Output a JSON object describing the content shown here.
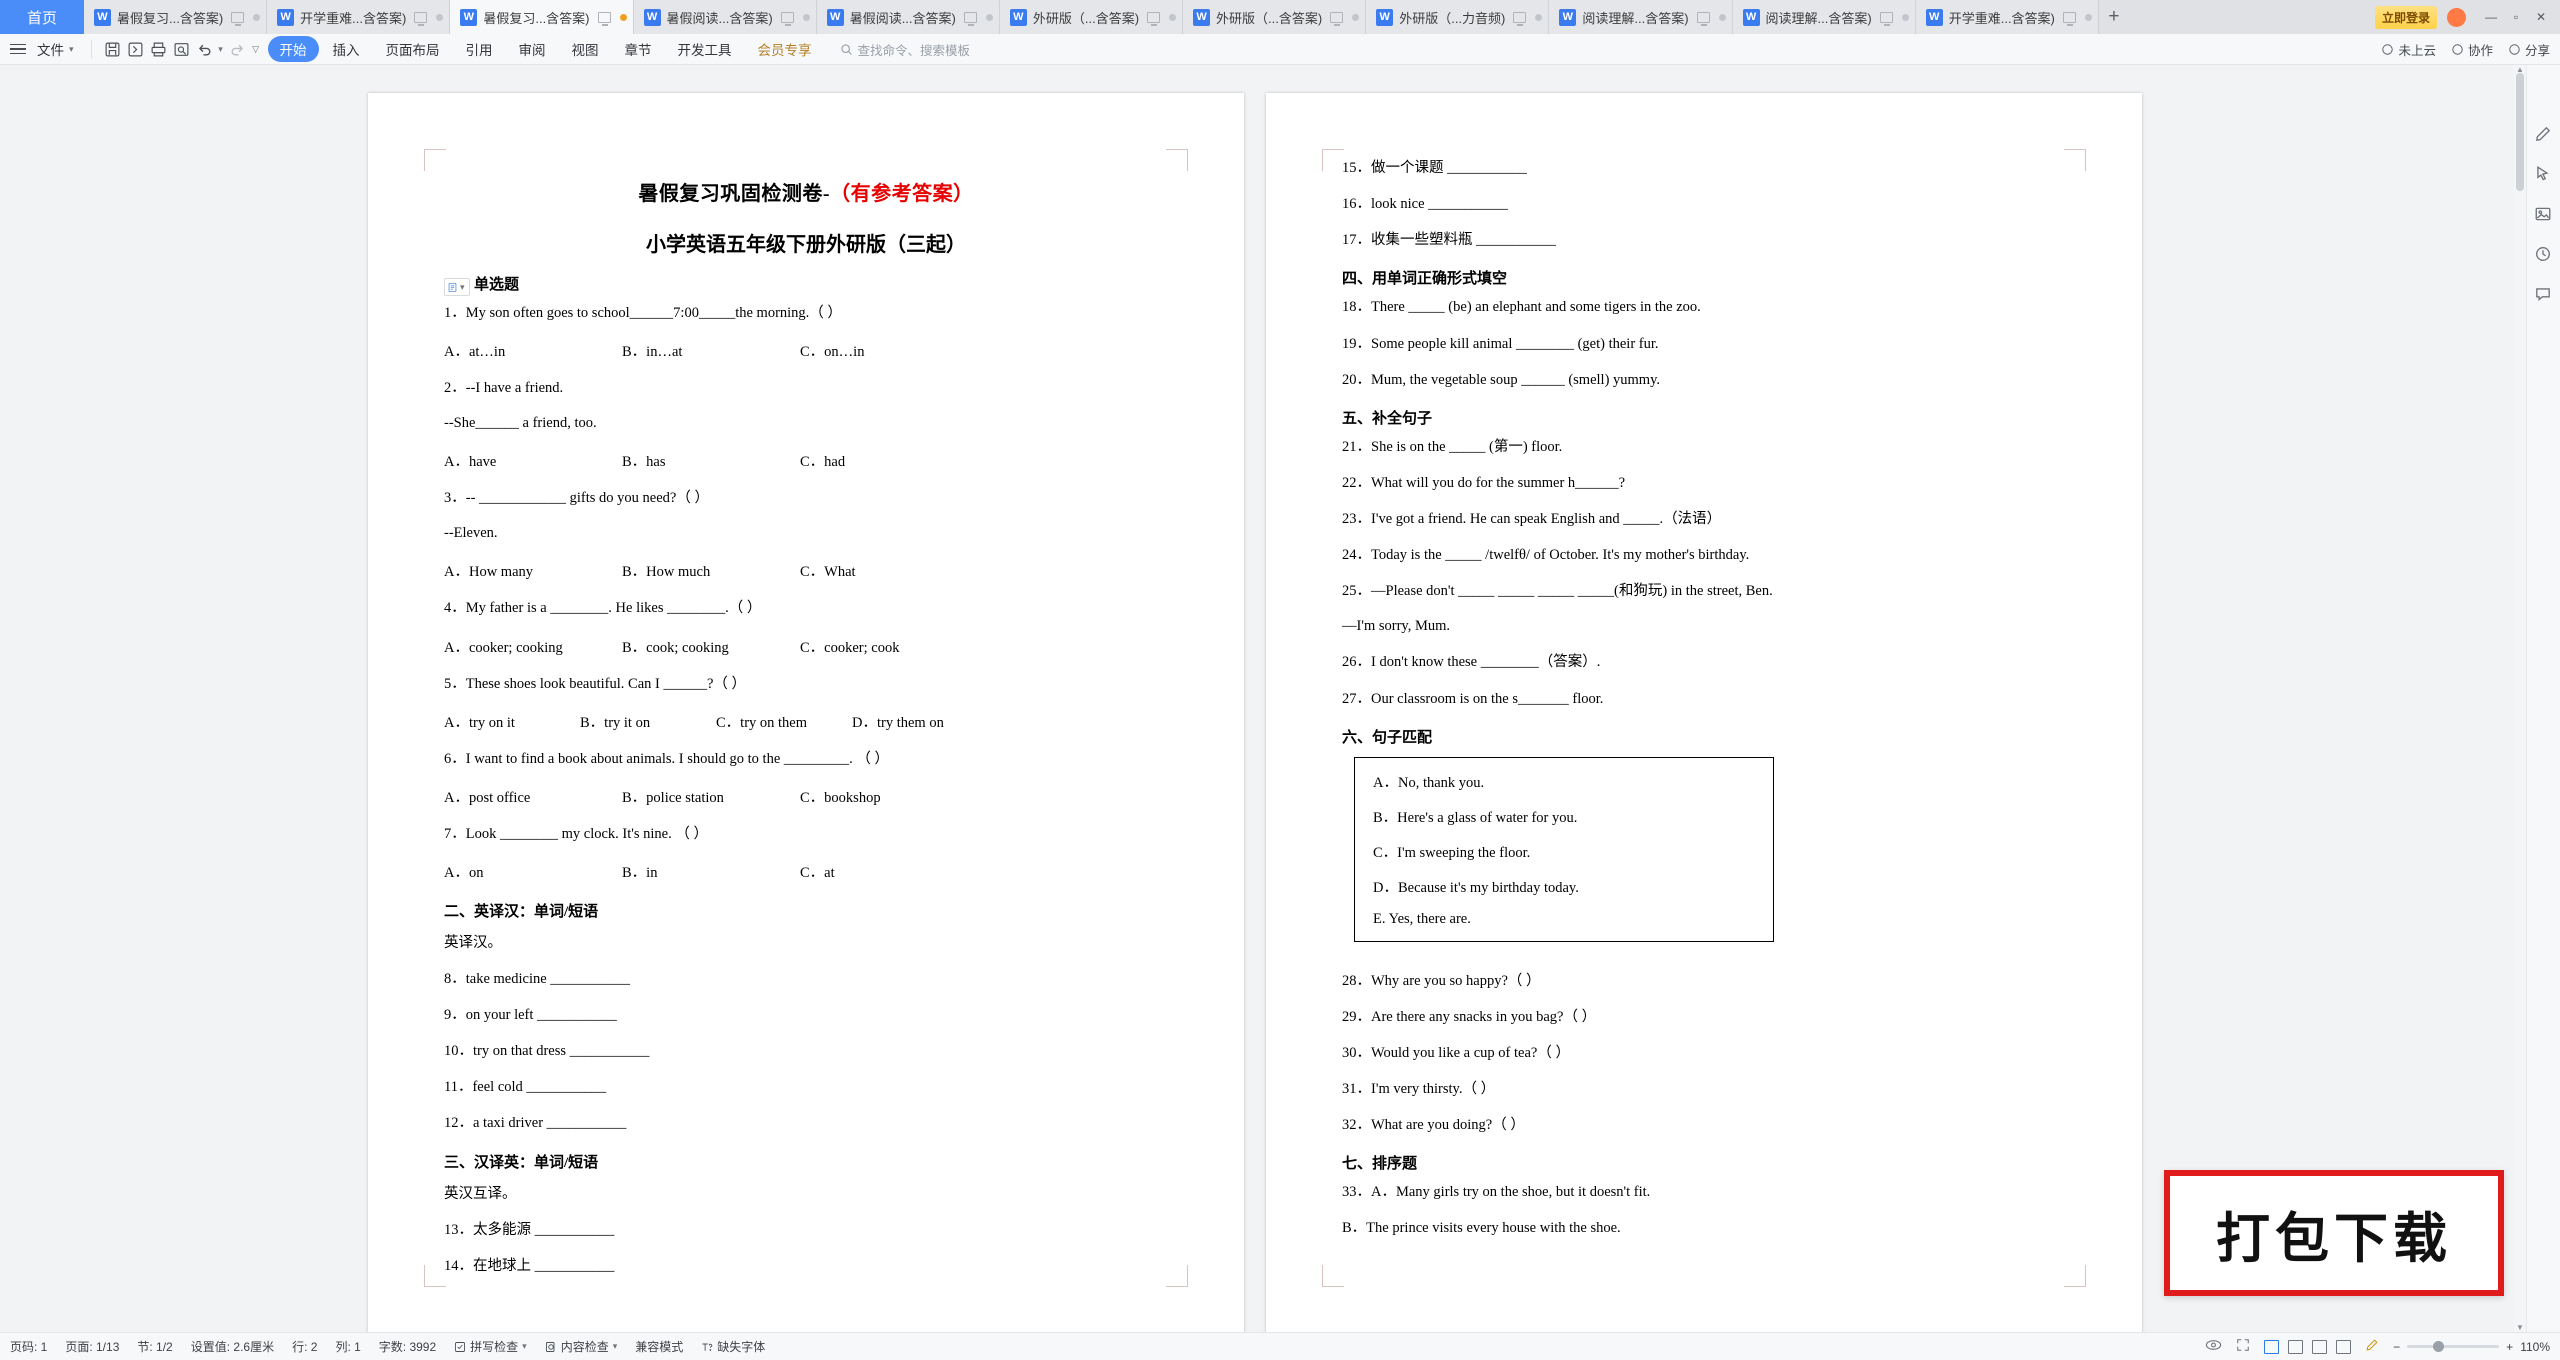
{
  "tabbar": {
    "home_label": "首页",
    "tabs": [
      {
        "label": "暑假复习...含答案)",
        "active": false,
        "dot": "grey"
      },
      {
        "label": "开学重难...含答案)",
        "active": false,
        "dot": "grey"
      },
      {
        "label": "暑假复习...含答案)",
        "active": true,
        "dot": "amber"
      },
      {
        "label": "暑假阅读...含答案)",
        "active": false,
        "dot": "grey"
      },
      {
        "label": "暑假阅读...含答案)",
        "active": false,
        "dot": "grey"
      },
      {
        "label": "外研版（...含答案)",
        "active": false,
        "dot": "grey"
      },
      {
        "label": "外研版（...含答案)",
        "active": false,
        "dot": "grey"
      },
      {
        "label": "外研版（...力音频)",
        "active": false,
        "dot": "grey"
      },
      {
        "label": "阅读理解...含答案)",
        "active": false,
        "dot": "grey"
      },
      {
        "label": "阅读理解...含答案)",
        "active": false,
        "dot": "grey"
      },
      {
        "label": "开学重难...含答案)",
        "active": false,
        "dot": "grey"
      }
    ],
    "new_tab": "+",
    "member_label": "立即登录",
    "window_buttons": [
      "—",
      "▫",
      "✕"
    ]
  },
  "ribbon": {
    "file_label": "文件",
    "quick_icons": [
      "save-icon",
      "save-as-icon",
      "print-icon",
      "print-preview-icon",
      "undo-icon",
      "redo-icon",
      "customize-icon"
    ],
    "tabs": [
      {
        "label": "开始",
        "active": true
      },
      {
        "label": "插入",
        "active": false
      },
      {
        "label": "页面布局",
        "active": false
      },
      {
        "label": "引用",
        "active": false
      },
      {
        "label": "审阅",
        "active": false
      },
      {
        "label": "视图",
        "active": false
      },
      {
        "label": "章节",
        "active": false
      },
      {
        "label": "开发工具",
        "active": false
      },
      {
        "label": "会员专享",
        "active": false,
        "gold": true
      }
    ],
    "search_placeholder": "查找命令、搜索模板",
    "right_items": [
      {
        "label": "未上云",
        "icon": "cloud-icon"
      },
      {
        "label": "协作",
        "icon": "collab-icon"
      },
      {
        "label": "分享",
        "icon": "share-icon"
      }
    ]
  },
  "document": {
    "title_main": "暑假复习巩固检测卷-",
    "title_red": "（有参考答案）",
    "subtitle": "小学英语五年级下册外研版（三起）",
    "left_page": {
      "sections": [
        {
          "type": "head",
          "text": "一、单选题"
        },
        {
          "type": "q",
          "text": "1．My son often goes to school______7:00_____the morning.（        ）"
        },
        {
          "type": "opts3",
          "a": "A．at…in",
          "b": "B．in…at",
          "c": "C．on…in"
        },
        {
          "type": "q",
          "text": "2．--I have a friend."
        },
        {
          "type": "plain",
          "text": "--She______ a friend, too."
        },
        {
          "type": "opts3",
          "a": "A．have",
          "b": "B．has",
          "c": "C．had"
        },
        {
          "type": "q",
          "text": "3．-- ____________ gifts do you need?（        ）"
        },
        {
          "type": "plain",
          "text": "--Eleven."
        },
        {
          "type": "opts3",
          "a": "A．How many",
          "b": "B．How much",
          "c": "C．What"
        },
        {
          "type": "q",
          "text": "4．My father is a ________. He likes ________.（        ）"
        },
        {
          "type": "opts3",
          "a": "A．cooker; cooking",
          "b": "B．cook; cooking",
          "c": "C．cooker; cook"
        },
        {
          "type": "q",
          "text": "5．These shoes look beautiful. Can I ______?（        ）"
        },
        {
          "type": "opts4",
          "a": "A．try on it",
          "b": "B．try it on",
          "c": "C．try on them",
          "d": "D．try them on"
        },
        {
          "type": "q",
          "text": "6．I want to find a book about animals. I should go to the _________.    （        ）"
        },
        {
          "type": "opts3",
          "a": "A．post office",
          "b": "B．police station",
          "c": "C．bookshop"
        },
        {
          "type": "q",
          "text": "7．Look ________ my clock. It's nine.    （        ）"
        },
        {
          "type": "opts3",
          "a": "A．on",
          "b": "B．in",
          "c": "C．at"
        },
        {
          "type": "head",
          "text": "二、英译汉：单词/短语"
        },
        {
          "type": "plain",
          "text": "英译汉。"
        },
        {
          "type": "q",
          "text": "8．take medicine ___________"
        },
        {
          "type": "q",
          "text": "9．on your left ___________"
        },
        {
          "type": "q",
          "text": "10．try on that dress ___________"
        },
        {
          "type": "q",
          "text": "11．feel cold ___________"
        },
        {
          "type": "q",
          "text": "12．a taxi driver ___________"
        },
        {
          "type": "head",
          "text": "三、汉译英：单词/短语"
        },
        {
          "type": "plain",
          "text": "英汉互译。"
        },
        {
          "type": "q",
          "text": "13．太多能源 ___________"
        },
        {
          "type": "q",
          "text": "14．在地球上 ___________"
        }
      ]
    },
    "right_page": {
      "sections": [
        {
          "type": "q",
          "text": "15．做一个课题 ___________"
        },
        {
          "type": "q",
          "text": "16．look nice ___________"
        },
        {
          "type": "q",
          "text": "17．收集一些塑料瓶 ___________"
        },
        {
          "type": "head",
          "text": "四、用单词正确形式填空"
        },
        {
          "type": "q",
          "text": "18．There _____ (be) an elephant and some tigers in the zoo."
        },
        {
          "type": "q",
          "text": "19．Some people kill animal ________ (get) their fur."
        },
        {
          "type": "q",
          "text": "20．Mum, the vegetable soup ______ (smell) yummy."
        },
        {
          "type": "head",
          "text": "五、补全句子"
        },
        {
          "type": "q",
          "text": "21．She is on the _____ (第一) floor."
        },
        {
          "type": "q",
          "text": "22．What will you do for the summer h______?"
        },
        {
          "type": "q",
          "text": "23．I've got a friend. He can speak English and _____.（法语）"
        },
        {
          "type": "q",
          "text": "24．Today is the _____ /twelfθ/ of October. It's my mother's birthday."
        },
        {
          "type": "q",
          "text": "25．—Please don't _____ _____ _____ _____(和狗玩) in the street, Ben."
        },
        {
          "type": "plain",
          "text": "—I'm sorry, Mum."
        },
        {
          "type": "q",
          "text": "26．I don't know these ________（答案）."
        },
        {
          "type": "q",
          "text": "27．Our classroom is on the s_______ floor."
        },
        {
          "type": "head",
          "text": "六、句子匹配"
        },
        {
          "type": "box",
          "items": [
            "A．No, thank you.",
            "B．Here's a glass of water for you.",
            "C．I'm sweeping the floor.",
            "D．Because it's my birthday today.",
            "E. Yes, there are."
          ]
        },
        {
          "type": "q",
          "text": "28．Why are you so happy?（        ）"
        },
        {
          "type": "q",
          "text": "29．Are there any snacks in you bag?（        ）"
        },
        {
          "type": "q",
          "text": "30．Would you like a cup of tea?（        ）"
        },
        {
          "type": "q",
          "text": "31．I'm very thirsty.（        ）"
        },
        {
          "type": "q",
          "text": "32．What are you doing?（        ）"
        },
        {
          "type": "head",
          "text": "七、排序题"
        },
        {
          "type": "q",
          "text": "33．A．Many girls try on the shoe, but it doesn't fit."
        },
        {
          "type": "q",
          "text": "B．The prince visits every house with the shoe."
        }
      ]
    }
  },
  "stamp": {
    "text": "打包下载"
  },
  "status": {
    "page_num_label": "页码: 1",
    "page_of_label": "页面: 1/13",
    "section_label": "节: 1/2",
    "setting_label": "设置值: 2.6厘米",
    "row_label": "行: 2",
    "col_label": "列: 1",
    "word_count_label": "字数: 3992",
    "spellcheck_label": "拼写检查",
    "content_check_label": "内容检查",
    "compat_label": "兼容模式",
    "missing_font_label": "缺失字体",
    "zoom_label": "110%",
    "zoom_minus": "−",
    "zoom_plus": "+"
  }
}
